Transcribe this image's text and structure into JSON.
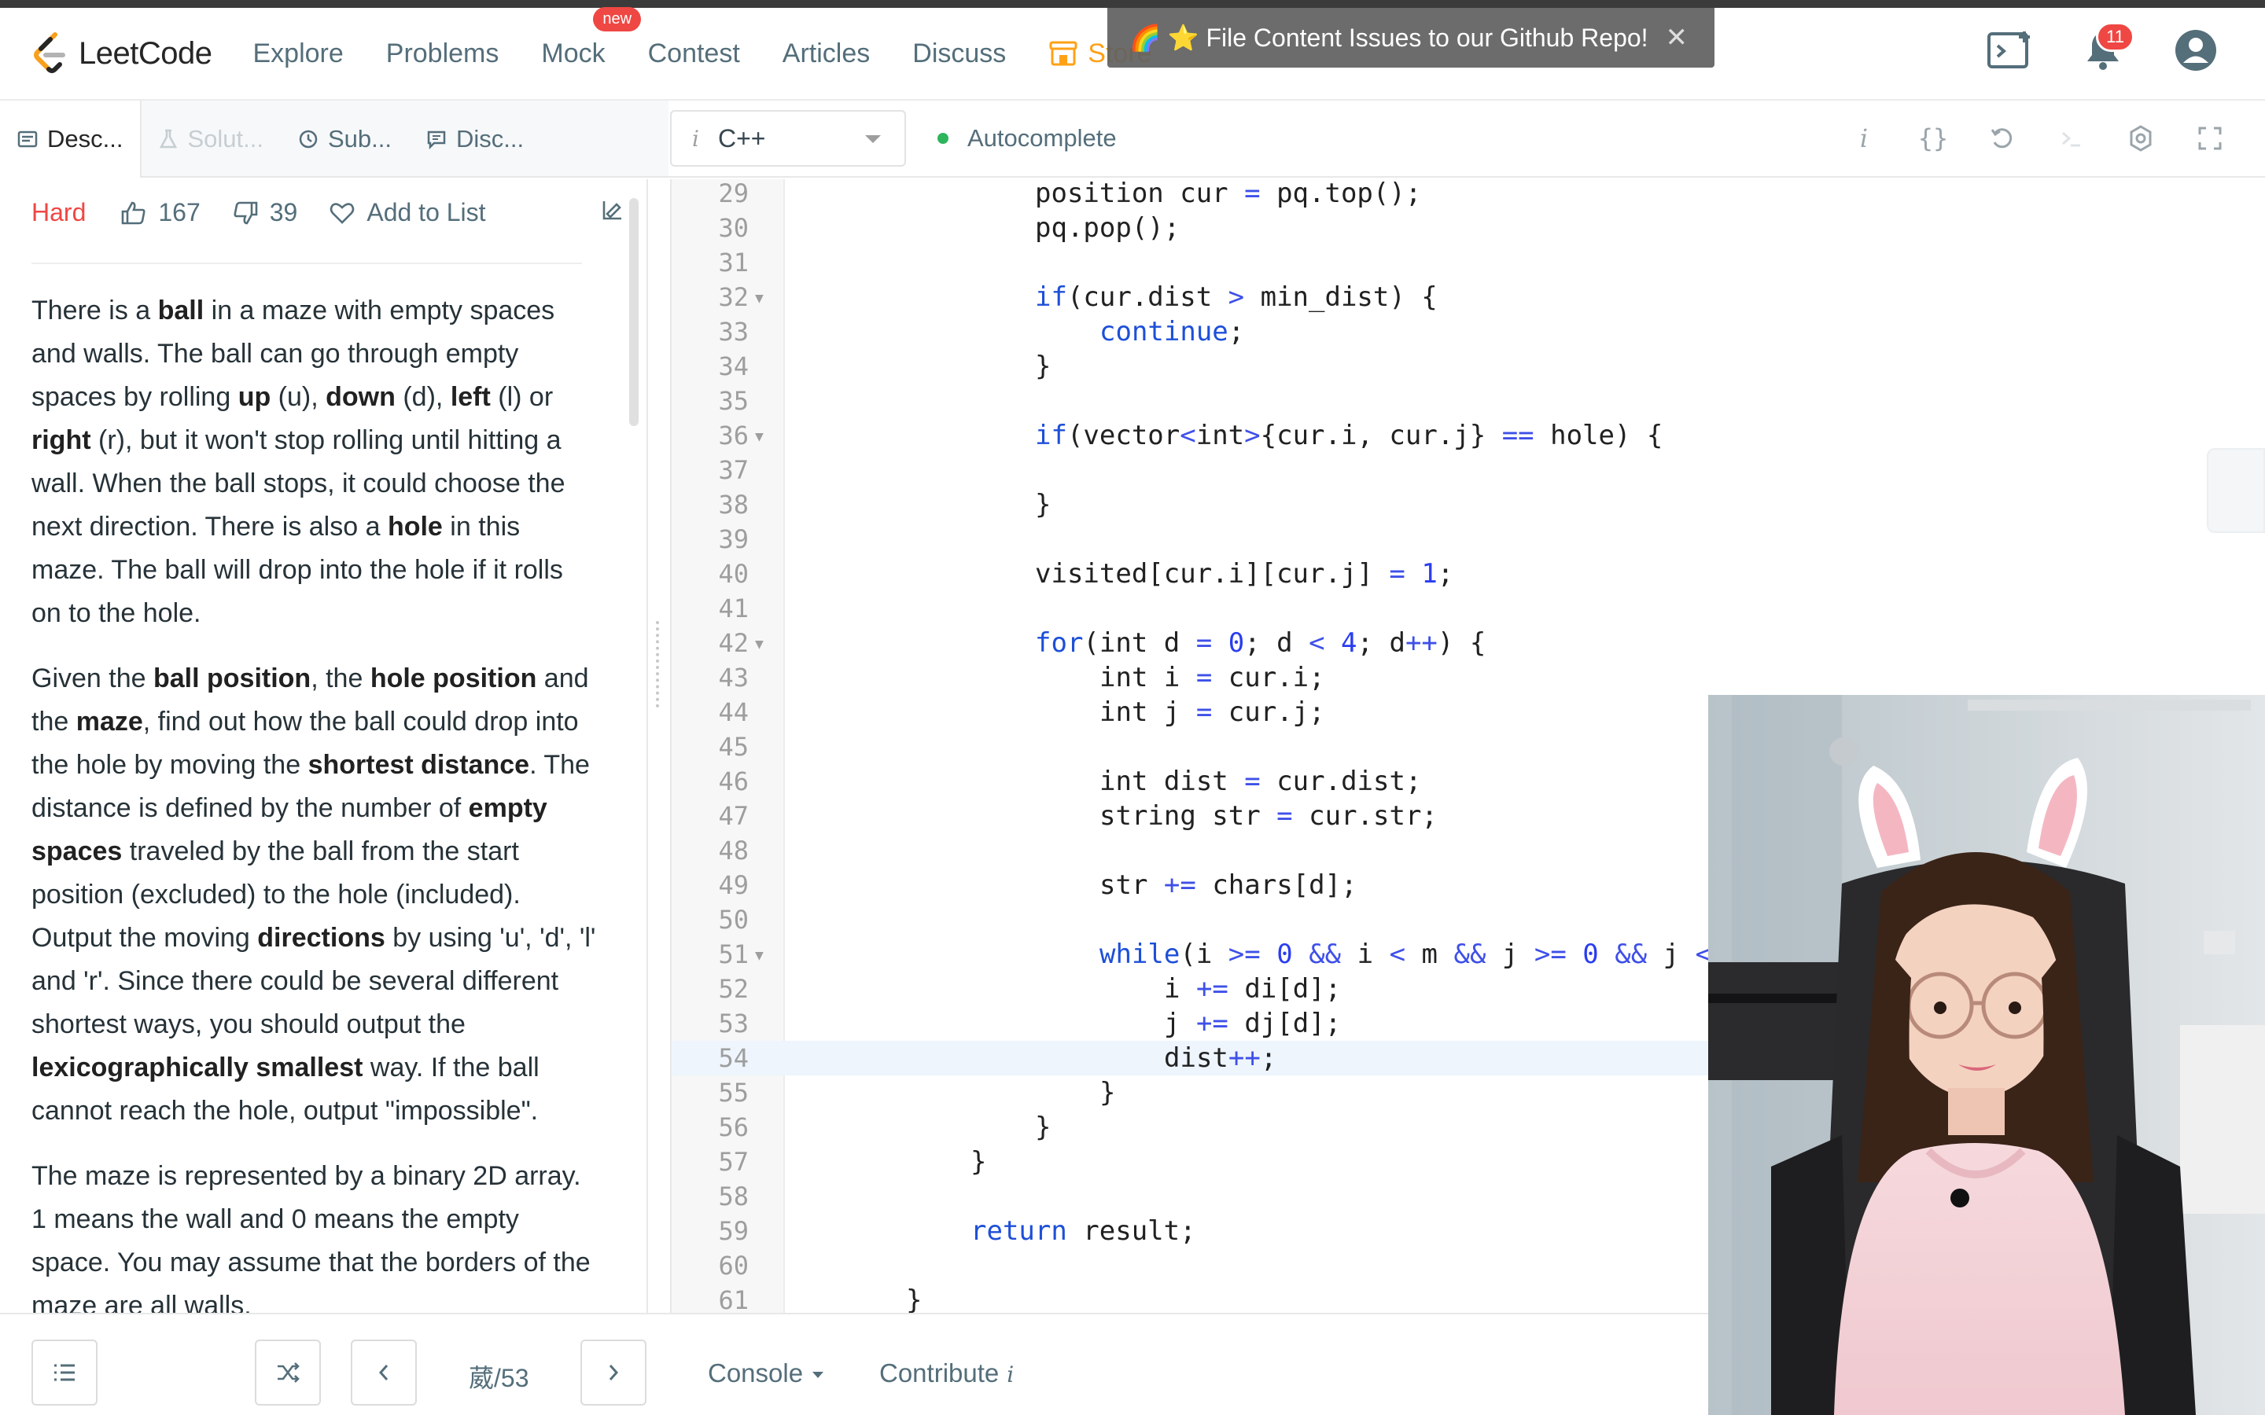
{
  "navbar": {
    "brand": "LeetCode",
    "links": [
      "Explore",
      "Problems",
      "Mock",
      "Contest",
      "Articles",
      "Discuss",
      "Store"
    ],
    "mock_badge": "new",
    "notification_count": "11"
  },
  "banner": {
    "text": "🌈 ⭐ File Content Issues to our Github Repo!",
    "close": "✕"
  },
  "tabs": [
    "Desc...",
    "Solut...",
    "Sub...",
    "Disc..."
  ],
  "editor_toolbar": {
    "language": "C++",
    "autocomplete": "Autocomplete"
  },
  "problem": {
    "difficulty": "Hard",
    "likes": "167",
    "dislikes": "39",
    "add_to_list": "Add to List"
  },
  "code_lines": [
    {
      "n": "29",
      "fold": false,
      "indent": 6,
      "text": "position cur = pq.top();"
    },
    {
      "n": "30",
      "fold": false,
      "indent": 6,
      "text": "pq.pop();"
    },
    {
      "n": "31",
      "fold": false,
      "indent": 0,
      "text": ""
    },
    {
      "n": "32",
      "fold": true,
      "indent": 6,
      "text": "if(cur.dist > min_dist) {"
    },
    {
      "n": "33",
      "fold": false,
      "indent": 8,
      "text": "continue;"
    },
    {
      "n": "34",
      "fold": false,
      "indent": 6,
      "text": "}"
    },
    {
      "n": "35",
      "fold": false,
      "indent": 0,
      "text": ""
    },
    {
      "n": "36",
      "fold": true,
      "indent": 6,
      "text": "if(vector<int>{cur.i, cur.j} == hole) {"
    },
    {
      "n": "37",
      "fold": false,
      "indent": 0,
      "text": ""
    },
    {
      "n": "38",
      "fold": false,
      "indent": 6,
      "text": "}"
    },
    {
      "n": "39",
      "fold": false,
      "indent": 0,
      "text": ""
    },
    {
      "n": "40",
      "fold": false,
      "indent": 6,
      "text": "visited[cur.i][cur.j] = 1;"
    },
    {
      "n": "41",
      "fold": false,
      "indent": 0,
      "text": ""
    },
    {
      "n": "42",
      "fold": true,
      "indent": 6,
      "text": "for(int d = 0; d < 4; d++) {"
    },
    {
      "n": "43",
      "fold": false,
      "indent": 8,
      "text": "int i = cur.i;"
    },
    {
      "n": "44",
      "fold": false,
      "indent": 8,
      "text": "int j = cur.j;"
    },
    {
      "n": "45",
      "fold": false,
      "indent": 0,
      "text": ""
    },
    {
      "n": "46",
      "fold": false,
      "indent": 8,
      "text": "int dist = cur.dist;"
    },
    {
      "n": "47",
      "fold": false,
      "indent": 8,
      "text": "string str = cur.str;"
    },
    {
      "n": "48",
      "fold": false,
      "indent": 0,
      "text": ""
    },
    {
      "n": "49",
      "fold": false,
      "indent": 8,
      "text": "str += chars[d];"
    },
    {
      "n": "50",
      "fold": false,
      "indent": 0,
      "text": ""
    },
    {
      "n": "51",
      "fold": true,
      "indent": 8,
      "text": "while(i >= 0 && i < m && j >= 0 && j < n"
    },
    {
      "n": "52",
      "fold": false,
      "indent": 10,
      "text": "i += di[d];"
    },
    {
      "n": "53",
      "fold": false,
      "indent": 10,
      "text": "j += dj[d];"
    },
    {
      "n": "54",
      "fold": false,
      "indent": 10,
      "text": "dist++;",
      "active": true
    },
    {
      "n": "55",
      "fold": false,
      "indent": 8,
      "text": "}"
    },
    {
      "n": "56",
      "fold": false,
      "indent": 6,
      "text": "}"
    },
    {
      "n": "57",
      "fold": false,
      "indent": 4,
      "text": "}"
    },
    {
      "n": "58",
      "fold": false,
      "indent": 0,
      "text": ""
    },
    {
      "n": "59",
      "fold": false,
      "indent": 4,
      "text": "return result;"
    },
    {
      "n": "60",
      "fold": false,
      "indent": 0,
      "text": ""
    },
    {
      "n": "61",
      "fold": false,
      "indent": 2,
      "text": "}"
    }
  ],
  "bottom": {
    "pager": "葳/53",
    "console": "Console",
    "contribute": "Contribute"
  },
  "colors": {
    "brand_orange": "#ffa116",
    "hard_red": "#ef4743",
    "keyword_blue": "#1d4fd8"
  }
}
